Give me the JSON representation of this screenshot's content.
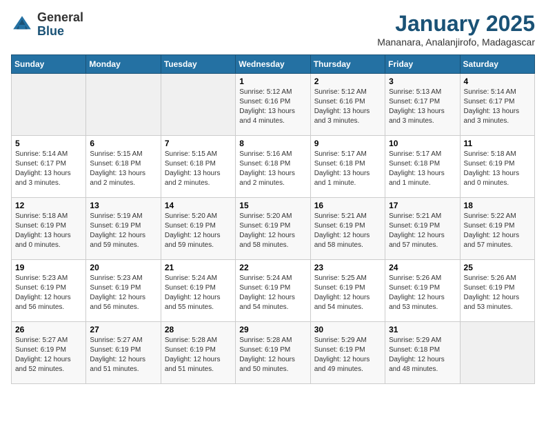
{
  "header": {
    "logo": {
      "general": "General",
      "blue": "Blue"
    },
    "title": "January 2025",
    "subtitle": "Mananara, Analanjirofo, Madagascar"
  },
  "weekdays": [
    "Sunday",
    "Monday",
    "Tuesday",
    "Wednesday",
    "Thursday",
    "Friday",
    "Saturday"
  ],
  "weeks": [
    [
      {
        "day": "",
        "sunrise": "",
        "sunset": "",
        "daylight": "",
        "empty": true
      },
      {
        "day": "",
        "sunrise": "",
        "sunset": "",
        "daylight": "",
        "empty": true
      },
      {
        "day": "",
        "sunrise": "",
        "sunset": "",
        "daylight": "",
        "empty": true
      },
      {
        "day": "1",
        "sunrise": "Sunrise: 5:12 AM",
        "sunset": "Sunset: 6:16 PM",
        "daylight": "Daylight: 13 hours and 4 minutes."
      },
      {
        "day": "2",
        "sunrise": "Sunrise: 5:12 AM",
        "sunset": "Sunset: 6:16 PM",
        "daylight": "Daylight: 13 hours and 3 minutes."
      },
      {
        "day": "3",
        "sunrise": "Sunrise: 5:13 AM",
        "sunset": "Sunset: 6:17 PM",
        "daylight": "Daylight: 13 hours and 3 minutes."
      },
      {
        "day": "4",
        "sunrise": "Sunrise: 5:14 AM",
        "sunset": "Sunset: 6:17 PM",
        "daylight": "Daylight: 13 hours and 3 minutes."
      }
    ],
    [
      {
        "day": "5",
        "sunrise": "Sunrise: 5:14 AM",
        "sunset": "Sunset: 6:17 PM",
        "daylight": "Daylight: 13 hours and 3 minutes."
      },
      {
        "day": "6",
        "sunrise": "Sunrise: 5:15 AM",
        "sunset": "Sunset: 6:18 PM",
        "daylight": "Daylight: 13 hours and 2 minutes."
      },
      {
        "day": "7",
        "sunrise": "Sunrise: 5:15 AM",
        "sunset": "Sunset: 6:18 PM",
        "daylight": "Daylight: 13 hours and 2 minutes."
      },
      {
        "day": "8",
        "sunrise": "Sunrise: 5:16 AM",
        "sunset": "Sunset: 6:18 PM",
        "daylight": "Daylight: 13 hours and 2 minutes."
      },
      {
        "day": "9",
        "sunrise": "Sunrise: 5:17 AM",
        "sunset": "Sunset: 6:18 PM",
        "daylight": "Daylight: 13 hours and 1 minute."
      },
      {
        "day": "10",
        "sunrise": "Sunrise: 5:17 AM",
        "sunset": "Sunset: 6:18 PM",
        "daylight": "Daylight: 13 hours and 1 minute."
      },
      {
        "day": "11",
        "sunrise": "Sunrise: 5:18 AM",
        "sunset": "Sunset: 6:19 PM",
        "daylight": "Daylight: 13 hours and 0 minutes."
      }
    ],
    [
      {
        "day": "12",
        "sunrise": "Sunrise: 5:18 AM",
        "sunset": "Sunset: 6:19 PM",
        "daylight": "Daylight: 13 hours and 0 minutes."
      },
      {
        "day": "13",
        "sunrise": "Sunrise: 5:19 AM",
        "sunset": "Sunset: 6:19 PM",
        "daylight": "Daylight: 12 hours and 59 minutes."
      },
      {
        "day": "14",
        "sunrise": "Sunrise: 5:20 AM",
        "sunset": "Sunset: 6:19 PM",
        "daylight": "Daylight: 12 hours and 59 minutes."
      },
      {
        "day": "15",
        "sunrise": "Sunrise: 5:20 AM",
        "sunset": "Sunset: 6:19 PM",
        "daylight": "Daylight: 12 hours and 58 minutes."
      },
      {
        "day": "16",
        "sunrise": "Sunrise: 5:21 AM",
        "sunset": "Sunset: 6:19 PM",
        "daylight": "Daylight: 12 hours and 58 minutes."
      },
      {
        "day": "17",
        "sunrise": "Sunrise: 5:21 AM",
        "sunset": "Sunset: 6:19 PM",
        "daylight": "Daylight: 12 hours and 57 minutes."
      },
      {
        "day": "18",
        "sunrise": "Sunrise: 5:22 AM",
        "sunset": "Sunset: 6:19 PM",
        "daylight": "Daylight: 12 hours and 57 minutes."
      }
    ],
    [
      {
        "day": "19",
        "sunrise": "Sunrise: 5:23 AM",
        "sunset": "Sunset: 6:19 PM",
        "daylight": "Daylight: 12 hours and 56 minutes."
      },
      {
        "day": "20",
        "sunrise": "Sunrise: 5:23 AM",
        "sunset": "Sunset: 6:19 PM",
        "daylight": "Daylight: 12 hours and 56 minutes."
      },
      {
        "day": "21",
        "sunrise": "Sunrise: 5:24 AM",
        "sunset": "Sunset: 6:19 PM",
        "daylight": "Daylight: 12 hours and 55 minutes."
      },
      {
        "day": "22",
        "sunrise": "Sunrise: 5:24 AM",
        "sunset": "Sunset: 6:19 PM",
        "daylight": "Daylight: 12 hours and 54 minutes."
      },
      {
        "day": "23",
        "sunrise": "Sunrise: 5:25 AM",
        "sunset": "Sunset: 6:19 PM",
        "daylight": "Daylight: 12 hours and 54 minutes."
      },
      {
        "day": "24",
        "sunrise": "Sunrise: 5:26 AM",
        "sunset": "Sunset: 6:19 PM",
        "daylight": "Daylight: 12 hours and 53 minutes."
      },
      {
        "day": "25",
        "sunrise": "Sunrise: 5:26 AM",
        "sunset": "Sunset: 6:19 PM",
        "daylight": "Daylight: 12 hours and 53 minutes."
      }
    ],
    [
      {
        "day": "26",
        "sunrise": "Sunrise: 5:27 AM",
        "sunset": "Sunset: 6:19 PM",
        "daylight": "Daylight: 12 hours and 52 minutes."
      },
      {
        "day": "27",
        "sunrise": "Sunrise: 5:27 AM",
        "sunset": "Sunset: 6:19 PM",
        "daylight": "Daylight: 12 hours and 51 minutes."
      },
      {
        "day": "28",
        "sunrise": "Sunrise: 5:28 AM",
        "sunset": "Sunset: 6:19 PM",
        "daylight": "Daylight: 12 hours and 51 minutes."
      },
      {
        "day": "29",
        "sunrise": "Sunrise: 5:28 AM",
        "sunset": "Sunset: 6:19 PM",
        "daylight": "Daylight: 12 hours and 50 minutes."
      },
      {
        "day": "30",
        "sunrise": "Sunrise: 5:29 AM",
        "sunset": "Sunset: 6:19 PM",
        "daylight": "Daylight: 12 hours and 49 minutes."
      },
      {
        "day": "31",
        "sunrise": "Sunrise: 5:29 AM",
        "sunset": "Sunset: 6:18 PM",
        "daylight": "Daylight: 12 hours and 48 minutes."
      },
      {
        "day": "",
        "sunrise": "",
        "sunset": "",
        "daylight": "",
        "empty": true
      }
    ]
  ]
}
